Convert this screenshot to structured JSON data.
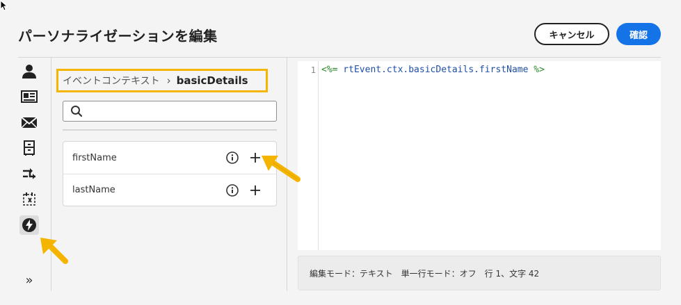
{
  "header": {
    "title": "パーソナライゼーションを編集",
    "cancel_label": "キャンセル",
    "confirm_label": "確認"
  },
  "left_rail": {
    "items": [
      {
        "icon": "user-icon"
      },
      {
        "icon": "profile-card-icon"
      },
      {
        "icon": "mail-icon"
      },
      {
        "icon": "cabinet-icon"
      },
      {
        "icon": "shuffle-icon"
      },
      {
        "icon": "calendar-function-icon"
      },
      {
        "icon": "lightning-icon",
        "selected": true
      }
    ],
    "expand_label": "»"
  },
  "browser": {
    "breadcrumb_parent": "イベントコンテキスト",
    "breadcrumb_separator": "›",
    "breadcrumb_current": "basicDetails",
    "search_placeholder": "",
    "fields": [
      {
        "label": "firstName"
      },
      {
        "label": "lastName"
      }
    ]
  },
  "editor": {
    "line_number": "1",
    "code_open": "<%=",
    "code_expr": " rtEvent.ctx.basicDetails.firstName ",
    "code_close": "%>"
  },
  "status_bar": {
    "text": "編集モード：テキスト　単一行モード：オフ　行 1、文字 42"
  },
  "colors": {
    "accent": "#1473e6",
    "highlight": "#f5b400",
    "code_tag": "#2a8a2a",
    "code_expr": "#1f4fa8"
  }
}
